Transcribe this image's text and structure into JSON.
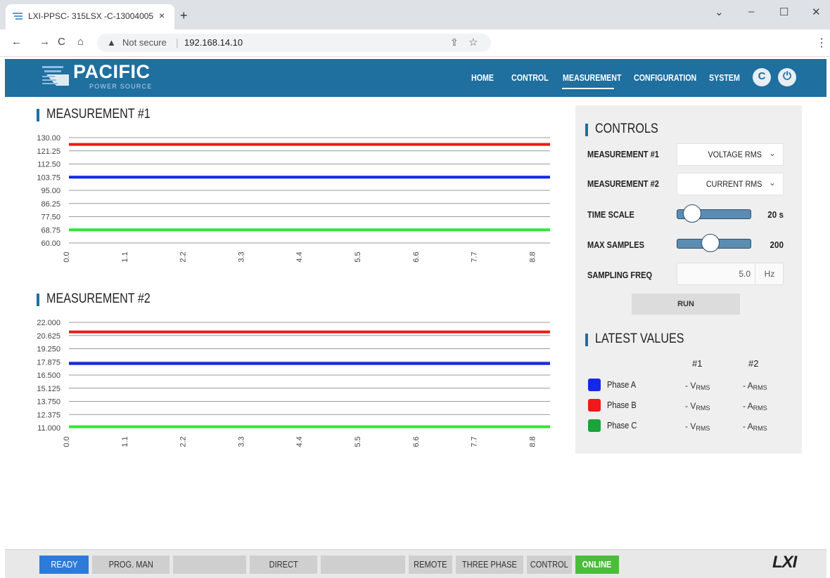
{
  "browser": {
    "tab_title": "LXI-PPSC- 315LSX -C-13004005",
    "new_tab": "+",
    "close_tab": "×",
    "security": "Not secure",
    "url": "192.168.14.10"
  },
  "app": {
    "logo": {
      "name": "PACIFIC",
      "sub": "POWER SOURCE"
    },
    "nav": [
      "HOME",
      "CONTROL",
      "MEASUREMENT",
      "CONFIGURATION",
      "SYSTEM"
    ],
    "active_nav": "MEASUREMENT"
  },
  "charts": [
    {
      "title": "MEASUREMENT #1",
      "y_ticks": [
        "130.00",
        "121.25",
        "112.50",
        "103.75",
        "95.00",
        "86.25",
        "77.50",
        "68.75",
        "60.00"
      ],
      "x_ticks": [
        "0.0",
        "1.1",
        "2.2",
        "3.3",
        "4.4",
        "5.5",
        "6.6",
        "7.7",
        "8.8"
      ]
    },
    {
      "title": "MEASUREMENT #2",
      "y_ticks": [
        "22.000",
        "20.625",
        "19.250",
        "17.875",
        "16.500",
        "15.125",
        "13.750",
        "12.375",
        "11.000"
      ],
      "x_ticks": [
        "0.0",
        "1.1",
        "2.2",
        "3.3",
        "4.4",
        "5.5",
        "6.6",
        "7.7",
        "8.8"
      ]
    }
  ],
  "chart_data": [
    {
      "type": "line",
      "title": "MEASUREMENT #1",
      "ylim": [
        60,
        130
      ],
      "xlim": [
        0,
        9.0
      ],
      "x": [
        0,
        9.0
      ],
      "series": [
        {
          "color": "#f01818",
          "values": [
            125.5,
            125.5
          ]
        },
        {
          "color": "#1428e6",
          "values": [
            103.75,
            103.75
          ]
        },
        {
          "color": "#33e633",
          "values": [
            68.75,
            68.75
          ]
        }
      ]
    },
    {
      "type": "line",
      "title": "MEASUREMENT #2",
      "ylim": [
        11,
        22
      ],
      "xlim": [
        0,
        9.0
      ],
      "x": [
        0,
        9.0
      ],
      "series": [
        {
          "color": "#f01818",
          "values": [
            21.0,
            21.0
          ]
        },
        {
          "color": "#1428e6",
          "values": [
            17.7,
            17.7
          ]
        },
        {
          "color": "#33e633",
          "values": [
            11.1,
            11.1
          ]
        }
      ]
    }
  ],
  "controls": {
    "title": "CONTROLS",
    "m1_label": "MEASUREMENT #1",
    "m1_value": "VOLTAGE RMS",
    "m2_label": "MEASUREMENT #2",
    "m2_value": "CURRENT RMS",
    "time_scale_label": "TIME SCALE",
    "time_scale_value": "20 s",
    "time_scale_level": 0.2,
    "max_samples_label": "MAX SAMPLES",
    "max_samples_value": "200",
    "max_samples_level": 0.45,
    "freq_label": "SAMPLING FREQ",
    "freq_value": "5.0",
    "freq_unit": "Hz",
    "run_label": "RUN"
  },
  "latest": {
    "title": "LATEST VALUES",
    "col1": "#1",
    "col2": "#2",
    "rows": [
      {
        "phase": "Phase A",
        "color": "#1428e6",
        "v1": "- V",
        "v1sub": "RMS",
        "v2": "- A",
        "v2sub": "RMS"
      },
      {
        "phase": "Phase B",
        "color": "#f01818",
        "v1": "- V",
        "v1sub": "RMS",
        "v2": "- A",
        "v2sub": "RMS"
      },
      {
        "phase": "Phase C",
        "color": "#1aa43a",
        "v1": "- V",
        "v1sub": "RMS",
        "v2": "- A",
        "v2sub": "RMS"
      }
    ]
  },
  "status": {
    "ready": "READY",
    "prog": "PROG. MAN",
    "blank1": "",
    "direct": "DIRECT",
    "blank2": "",
    "remote": "REMOTE",
    "phase": "THREE PHASE",
    "control": "CONTROL",
    "online": "ONLINE",
    "lxi": "LXI"
  },
  "colors": {
    "brand": "#1f6f9f",
    "ready": "#2e7ad8",
    "online": "#4cbc3c"
  }
}
